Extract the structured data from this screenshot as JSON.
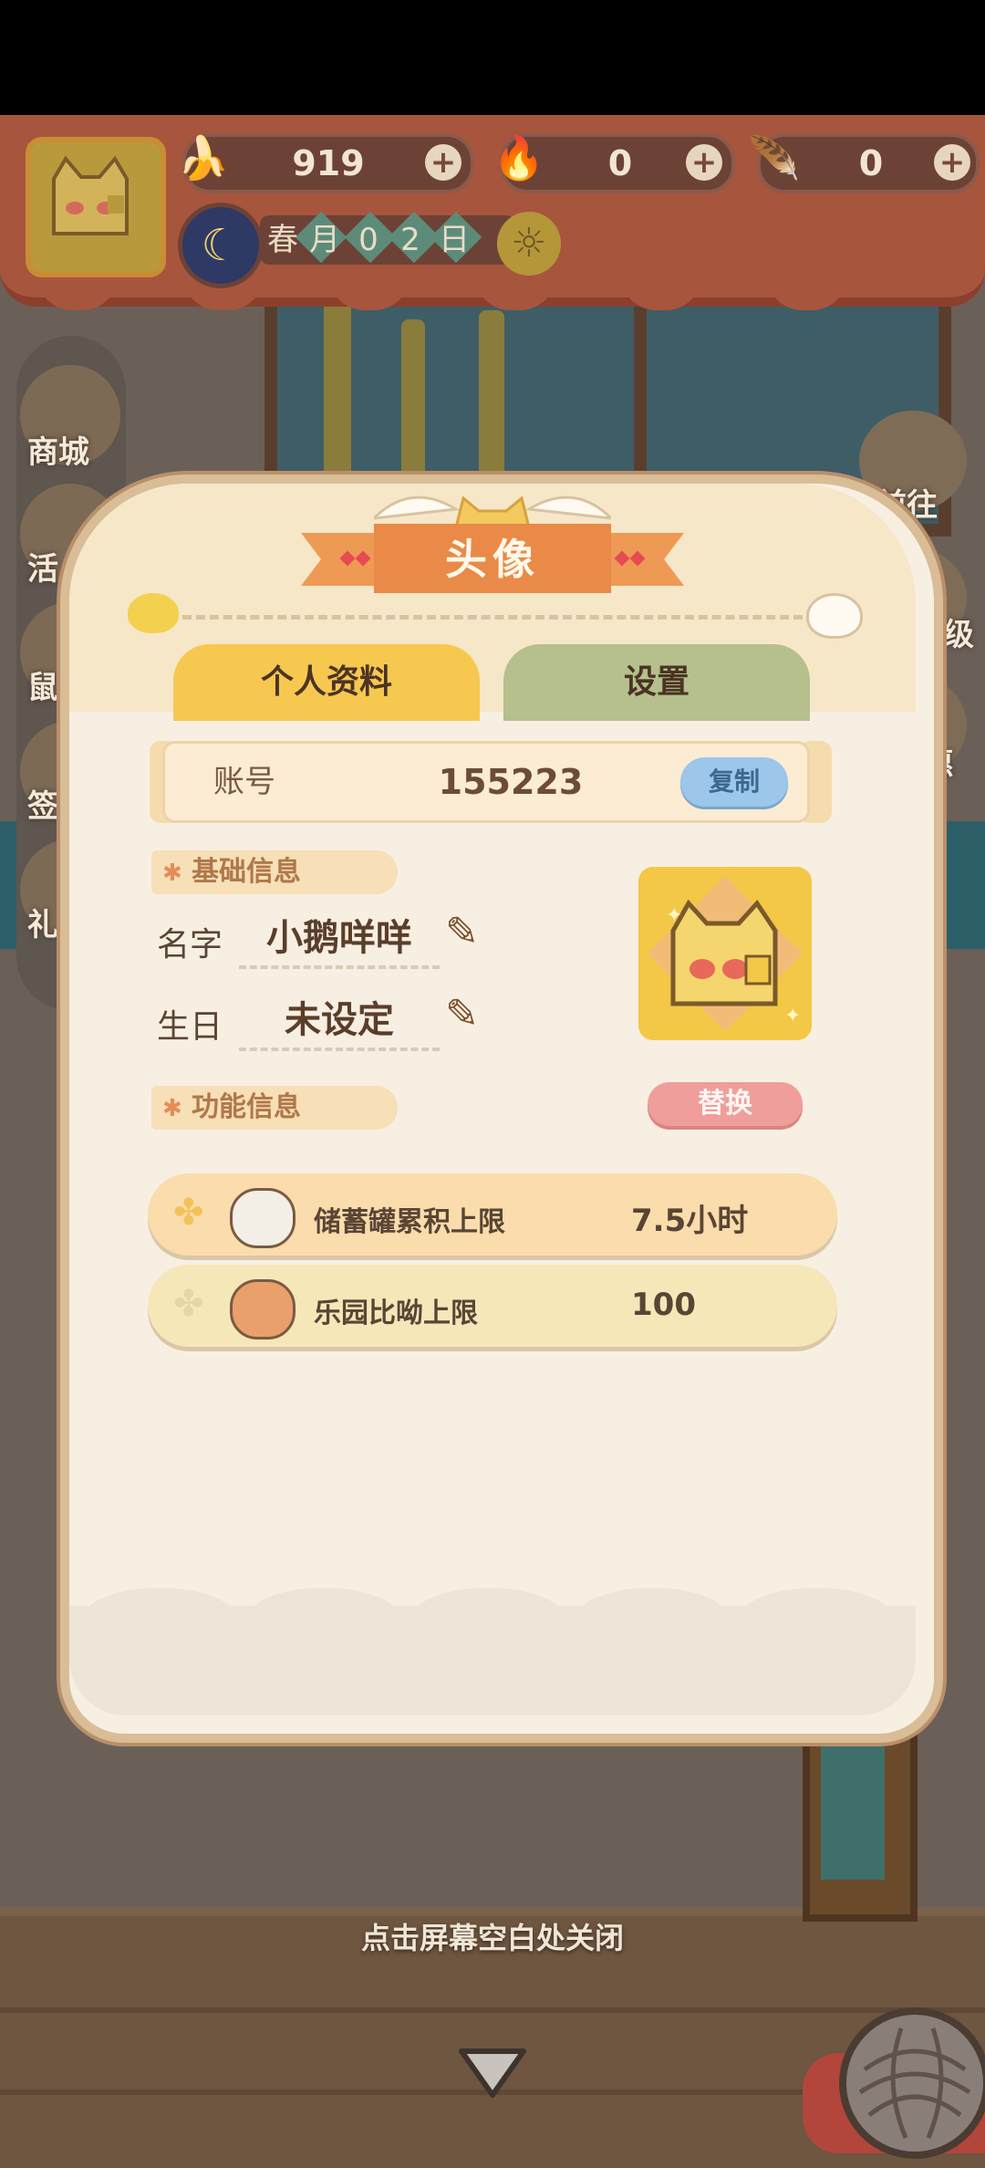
{
  "hud": {
    "bananas": "919",
    "blue_flames": "0",
    "feathers": "0",
    "plus": "+",
    "date_chars": [
      "春",
      "月",
      "0",
      "2",
      "日"
    ]
  },
  "side_menu_left": [
    "商城",
    "活",
    "鼠",
    "签",
    "礼"
  ],
  "side_menu_right": [
    "前往",
    "等级",
    "惠"
  ],
  "modal": {
    "title": "头像",
    "tabs": [
      {
        "label": "个人资料",
        "active": true
      },
      {
        "label": "设置",
        "active": false
      }
    ],
    "account": {
      "label": "账号",
      "value": "155223",
      "copy_label": "复制"
    },
    "basic_section": "基础信息",
    "name": {
      "label": "名字",
      "value": "小鹅咩咩"
    },
    "birthday": {
      "label": "生日",
      "value": "未设定"
    },
    "replace_label": "替换",
    "function_section": "功能信息",
    "stats": [
      {
        "label": "储蓄罐累积上限",
        "value": "7.5小时"
      },
      {
        "label": "乐园比呦上限",
        "value": "100"
      }
    ]
  },
  "close_hint": "点击屏幕空白处关闭",
  "colors": {
    "accent": "#f7c850",
    "ribbon": "#ee9a55",
    "settings_tab": "#b5c08c",
    "copy": "#9cc6ea",
    "replace": "#ef9e9b"
  },
  "icons": [
    "banana-icon",
    "flame-icon",
    "feather-icon",
    "moon-clock-icon",
    "sun-icon",
    "pencil-icon",
    "clover-icon",
    "yarn-ball-icon",
    "down-arrow-icon"
  ]
}
